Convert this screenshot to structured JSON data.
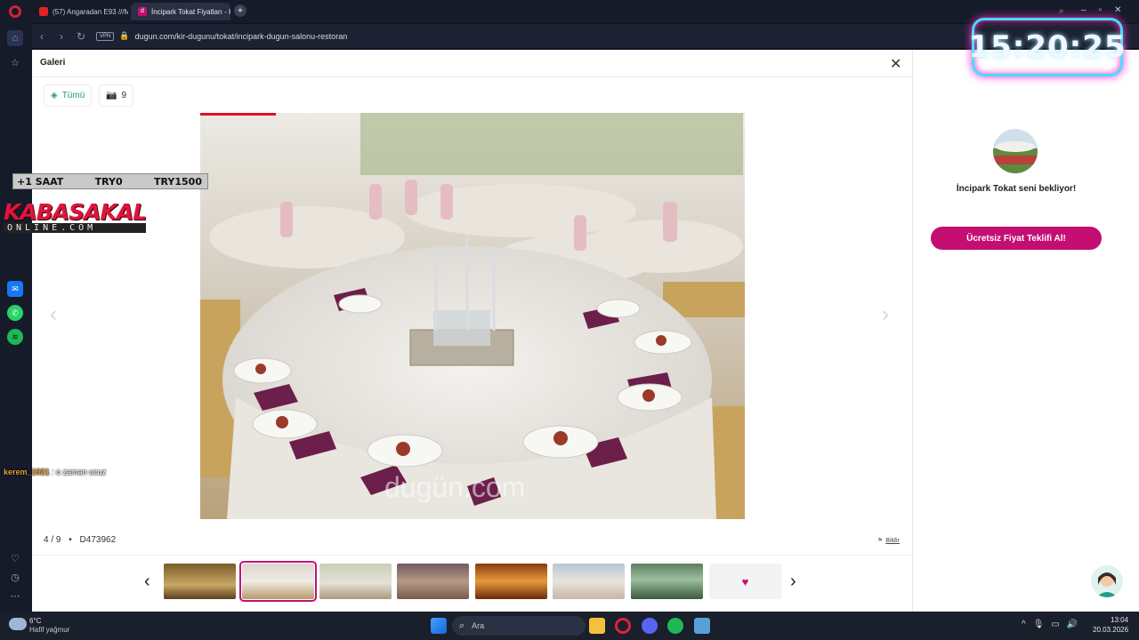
{
  "tabs": [
    {
      "label": "(57) Angaradan E93 ///M"
    },
    {
      "label": "İncipark Tokat Fiyatları - K"
    }
  ],
  "address": {
    "vpn_label": "VPN",
    "url": "dugun.com/kir-dugunu/tokat/incipark-dugun-salonu-restoran"
  },
  "gallery": {
    "title": "Galeri",
    "filter_all": "Tümü",
    "photo_count": "9",
    "position": "4 / 9",
    "separator": "•",
    "photo_id": "D473962",
    "report_label": "Bildir",
    "watermark": "dugün.com",
    "thumbnails": [
      "ballroom-chandelier",
      "round-table-setup",
      "garden-tables",
      "hall-lights",
      "orange-lit-hall",
      "outdoor-tables",
      "garden-trees",
      "favorite"
    ],
    "active_thumbnail_index": 1
  },
  "sidebar_panel": {
    "venue_text": "İncipark Tokat seni bekliyor!",
    "cta_label": "Ücretsiz Fiyat Teklifi Al!"
  },
  "overlay": {
    "clock": "15:20:25",
    "price_items": [
      "+1 SAAT",
      "TRY0",
      "TRY1500"
    ],
    "brand_main": "KABASAKAL",
    "brand_sub": "ONLINE.COM",
    "chat_user": "kerem_1921",
    "chat_message": ": o zaman ucuz"
  },
  "taskbar": {
    "weather_temp": "6°C",
    "weather_desc": "Hafif yağmur",
    "search_label": "Ara",
    "time": "13:04",
    "date": "20.03.2026"
  },
  "colors": {
    "accent": "#c40e72",
    "filter_green": "#1f9d6a"
  }
}
